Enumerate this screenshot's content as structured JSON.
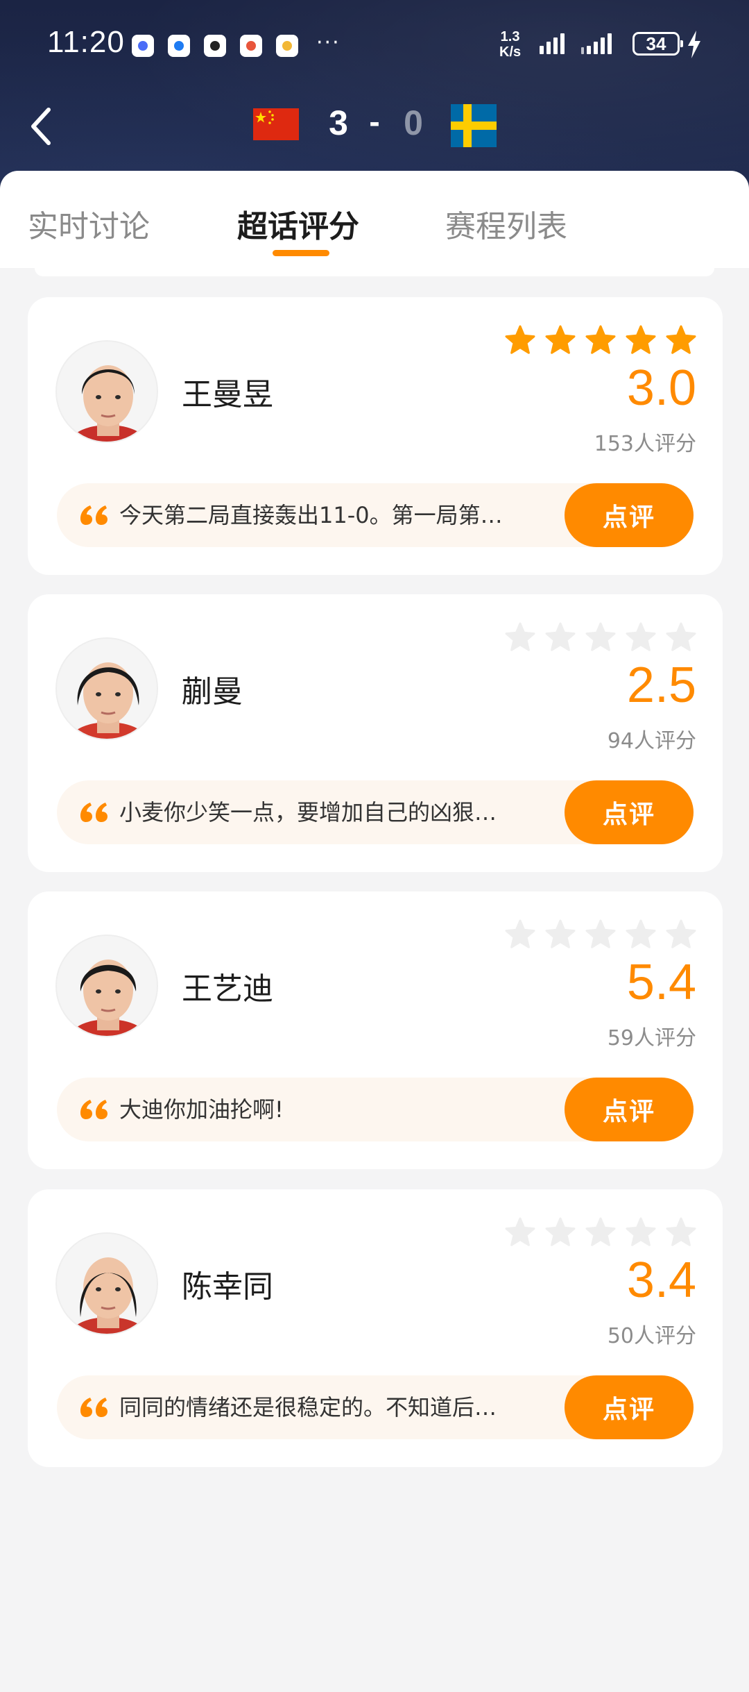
{
  "status_bar": {
    "time": "11:20",
    "net_speed_value": "1.3",
    "net_speed_unit": "K/s",
    "battery": "34",
    "more": "···"
  },
  "match": {
    "home_score": "3",
    "separator": "-",
    "away_score": "0"
  },
  "tabs": [
    {
      "label": "实时讨论",
      "active": false
    },
    {
      "label": "超话评分",
      "active": true
    },
    {
      "label": "赛程列表",
      "active": false
    }
  ],
  "players": [
    {
      "name": "王曼昱",
      "score": "3.0",
      "count": "153人评分",
      "stars_highlighted": true,
      "comment": "今天第二局直接轰出11-0。第一局第…",
      "button": "点评"
    },
    {
      "name": "蒯曼",
      "score": "2.5",
      "count": "94人评分",
      "stars_highlighted": false,
      "comment": "小麦你少笑一点，要增加自己的凶狠…",
      "button": "点评"
    },
    {
      "name": "王艺迪",
      "score": "5.4",
      "count": "59人评分",
      "stars_highlighted": false,
      "comment": "大迪你加油抡啊!",
      "button": "点评"
    },
    {
      "name": "陈幸同",
      "score": "3.4",
      "count": "50人评分",
      "stars_highlighted": false,
      "comment": "同同的情绪还是很稳定的。不知道后…",
      "button": "点评"
    }
  ],
  "colors": {
    "accent": "#ff8a00",
    "star_active": "#ff9c00",
    "star_inactive": "#eeeeee",
    "header_bg": "#1f2a4d"
  },
  "icons": {
    "back": "chevron-left-icon",
    "star": "star-icon",
    "quote": "quote-icon",
    "bolt": "charging-icon"
  }
}
